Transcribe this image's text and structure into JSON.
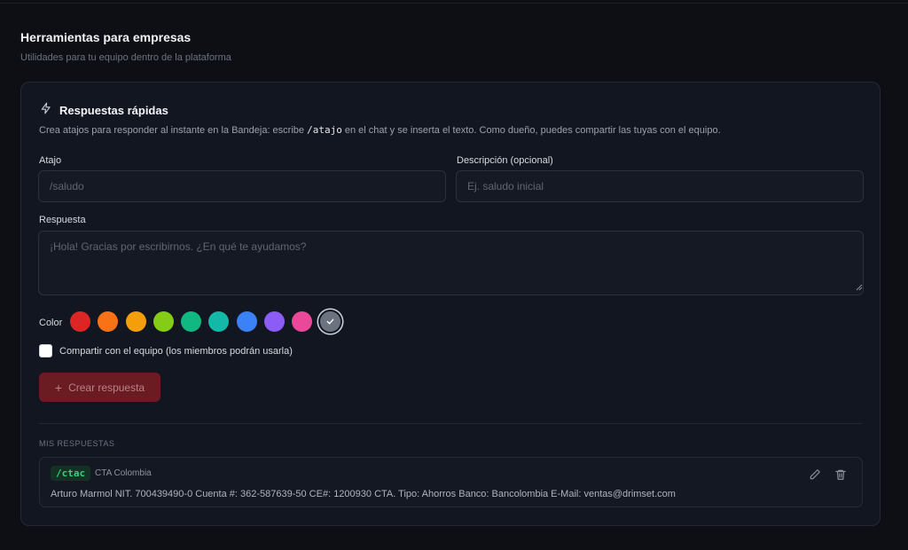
{
  "section": {
    "title": "Herramientas para empresas",
    "subtitle": "Utilidades para tu equipo dentro de la plataforma"
  },
  "card": {
    "icon": "lightning-icon",
    "title": "Respuestas rápidas",
    "desc_before": "Crea atajos para responder al instante en la Bandeja: escribe ",
    "desc_code": "/atajo",
    "desc_after": " en el chat y se inserta el texto. Como dueño, puedes compartir las tuyas con el equipo."
  },
  "form": {
    "shortcut_label": "Atajo",
    "shortcut_placeholder": "/saludo",
    "shortcut_value": "",
    "description_label": "Descripción (opcional)",
    "description_placeholder": "Ej. saludo inicial",
    "description_value": "",
    "response_label": "Respuesta",
    "response_placeholder": "¡Hola! Gracias por escribirnos. ¿En qué te ayudamos?",
    "response_value": "",
    "color_label": "Color",
    "colors": [
      "#dc2626",
      "#f97316",
      "#f59e0b",
      "#84cc16",
      "#10b981",
      "#14b8a6",
      "#3b82f6",
      "#8b5cf6",
      "#ec4899",
      "#6b7280"
    ],
    "selected_color_index": 9,
    "share_label": "Compartir con el equipo (los miembros podrán usarla)",
    "share_checked": false,
    "create_button": "Crear respuesta",
    "create_icon": "plus-icon"
  },
  "list": {
    "heading": "MIS RESPUESTAS",
    "items": [
      {
        "shortcut": "/ctac",
        "description": "CTA Colombia",
        "body": "Arturo Marmol NIT. 700439490-0 Cuenta #: 362-587639-50 CE#: 1200930 CTA. Tipo: Ahorros Banco: Bancolombia E-Mail: ventas@drimset.com",
        "edit_icon": "pencil-icon",
        "delete_icon": "trash-icon"
      }
    ]
  }
}
